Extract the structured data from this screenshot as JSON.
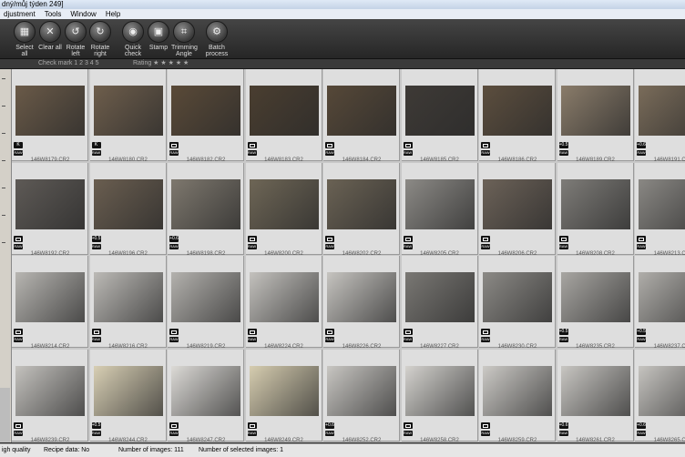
{
  "window": {
    "title": "dný/můj týden 249]"
  },
  "menu": [
    "djustment",
    "Tools",
    "Window",
    "Help"
  ],
  "toolbar": [
    {
      "label": "Select all",
      "icon": "select-all-icon",
      "glyph": "▦"
    },
    {
      "label": "Clear all",
      "icon": "clear-all-icon",
      "glyph": "✕"
    },
    {
      "label": "Rotate left",
      "icon": "rotate-left-icon",
      "glyph": "↺"
    },
    {
      "label": "Rotate right",
      "icon": "rotate-right-icon",
      "glyph": "↻"
    },
    {
      "label": "Quick\ncheck",
      "icon": "quick-check-icon",
      "glyph": "◉"
    },
    {
      "label": "Stamp",
      "icon": "stamp-icon",
      "glyph": "▣"
    },
    {
      "label": "Trimming\nAngle",
      "icon": "trimming-angle-icon",
      "glyph": "⌗"
    },
    {
      "label": "Batch\nprocess",
      "icon": "batch-process-icon",
      "glyph": "⚙"
    }
  ],
  "ratingbar": {
    "check_mark": "Check mark  1  2  3  4  5",
    "rating": "Rating  ★  ★  ★  ★  ★"
  },
  "rows": [
    [
      {
        "name": "146W8179.CR2",
        "b1": "K",
        "b2": "RAW",
        "tone": "#6a5a48"
      },
      {
        "name": "146W8180.CR2",
        "b1": "K",
        "b2": "RAW",
        "tone": "#6e5e4c"
      },
      {
        "name": "146W8182.CR2",
        "b1": "",
        "b2": "RAW",
        "tone": "#5a4a38"
      },
      {
        "name": "146W8183.CR2",
        "b1": "",
        "b2": "RAW",
        "tone": "#4a3e30"
      },
      {
        "name": "146W8184.CR2",
        "b1": "",
        "b2": "RAW",
        "tone": "#564838"
      },
      {
        "name": "146W8185.CR2",
        "b1": "",
        "b2": "RAW",
        "tone": "#3e3a36"
      },
      {
        "name": "146W8186.CR2",
        "b1": "",
        "b2": "RAW",
        "tone": "#5c4e3e"
      },
      {
        "name": "146W8189.CR2",
        "b1": "+0.5",
        "b2": "RAW",
        "tone": "#8a7c6a"
      },
      {
        "name": "146W8191.CR2",
        "b1": "+0.6",
        "b2": "RAW",
        "tone": "#7a6c5a"
      }
    ],
    [
      {
        "name": "146W8192.CR2",
        "b1": "",
        "b2": "RAW",
        "tone": "#5e5a56"
      },
      {
        "name": "146W8196.CR2",
        "b1": "+0.5",
        "b2": "RAW",
        "tone": "#6a5e50"
      },
      {
        "name": "146W8198.CR2",
        "b1": "+0.6",
        "b2": "RAW",
        "tone": "#7e786e"
      },
      {
        "name": "146W8200.CR2",
        "b1": "",
        "b2": "RAW",
        "tone": "#6e6656"
      },
      {
        "name": "146W8202.CR2",
        "b1": "",
        "b2": "RAW",
        "tone": "#6a6254"
      },
      {
        "name": "146W8205.CR2",
        "b1": "",
        "b2": "RAW",
        "tone": "#8c8a86"
      },
      {
        "name": "146W8206.CR2",
        "b1": "",
        "b2": "RAW",
        "tone": "#6c6258"
      },
      {
        "name": "146W8208.CR2",
        "b1": "",
        "b2": "RAW",
        "tone": "#7e7c78"
      },
      {
        "name": "146W8213.CR2",
        "b1": "",
        "b2": "RAW",
        "tone": "#8a8884"
      }
    ],
    [
      {
        "name": "146W8214.CR2",
        "b1": "",
        "b2": "RAW",
        "tone": "#b8b6b2"
      },
      {
        "name": "146W8216.CR2",
        "b1": "",
        "b2": "RAW",
        "tone": "#bcbab6"
      },
      {
        "name": "146W8219.CR2",
        "b1": "",
        "b2": "RAW",
        "tone": "#b4b2ae"
      },
      {
        "name": "146W8224.CR2",
        "b1": "",
        "b2": "RAW",
        "tone": "#c4c2be"
      },
      {
        "name": "146W8226.CR2",
        "b1": "",
        "b2": "RAW",
        "tone": "#c6c4c0"
      },
      {
        "name": "146W8227.CR2",
        "b1": "",
        "b2": "RAW",
        "tone": "#7a7874"
      },
      {
        "name": "146W8230.CR2",
        "b1": "",
        "b2": "RAW",
        "tone": "#8c8a86"
      },
      {
        "name": "146W8235.CR2",
        "b1": "+0.5",
        "b2": "RAW",
        "tone": "#a8a6a2"
      },
      {
        "name": "146W8237.CR2",
        "b1": "+0.5",
        "b2": "RAW",
        "tone": "#b0aeaa"
      }
    ],
    [
      {
        "name": "146W8239.CR2",
        "b1": "",
        "b2": "RAW",
        "tone": "#c4c2be"
      },
      {
        "name": "146W8244.CR2",
        "b1": "+0.5",
        "b2": "RAW",
        "tone": "#d8cfb4"
      },
      {
        "name": "146W8247.CR2",
        "b1": "",
        "b2": "RAW",
        "tone": "#dcdad6"
      },
      {
        "name": "146W8249.CR2",
        "b1": "",
        "b2": "RAW",
        "tone": "#d6cdb0"
      },
      {
        "name": "146W8252.CR2",
        "b1": "+0.6",
        "b2": "RAW",
        "tone": "#c8c6c2"
      },
      {
        "name": "146W8258.CR2",
        "b1": "",
        "b2": "RAW",
        "tone": "#d4d2ce"
      },
      {
        "name": "146W8259.CR2",
        "b1": "",
        "b2": "RAW",
        "tone": "#cccac6"
      },
      {
        "name": "146W8261.CR2",
        "b1": "+0.6",
        "b2": "RAW",
        "tone": "#c8c6c2"
      },
      {
        "name": "146W8265.CR2",
        "b1": "+0.6",
        "b2": "RAW",
        "tone": "#c6c4c0"
      }
    ]
  ],
  "status": {
    "quality": "igh quality",
    "recipe": "Recipe data: No",
    "count": "Number of images: 111",
    "selected": "Number of selected images: 1"
  }
}
